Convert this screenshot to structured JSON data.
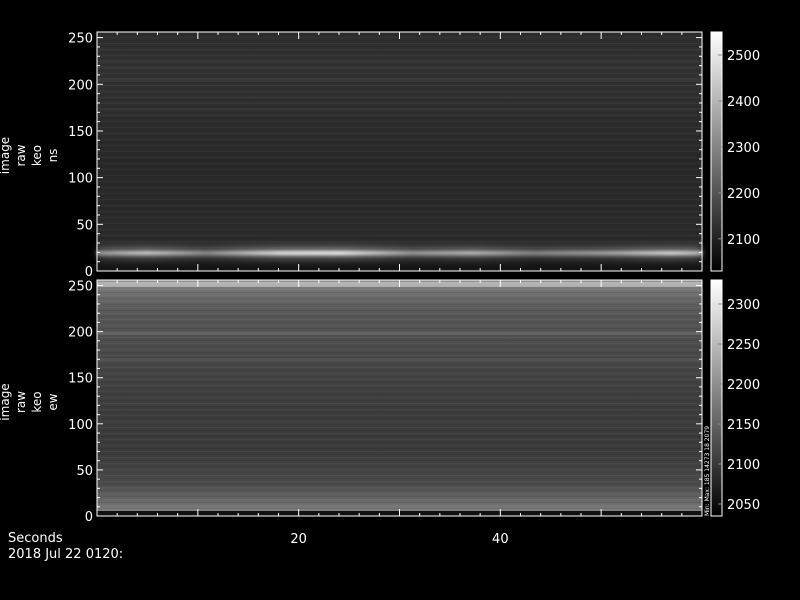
{
  "chart_data": [
    {
      "type": "heatmap",
      "panel": "top",
      "ylabel_lines": [
        "image",
        "raw",
        "keo",
        "ns"
      ],
      "ylim": [
        0,
        256
      ],
      "yticks": [
        0,
        50,
        100,
        150,
        200,
        250
      ],
      "xlim": [
        0,
        60
      ],
      "colorbar": {
        "min": 2030,
        "max": 2550,
        "ticks": [
          2100,
          2200,
          2300,
          2400,
          2500
        ]
      },
      "features": [
        {
          "row": 14,
          "description": "bright aurora band",
          "peak_value": 2550
        },
        {
          "row_range": [
            0,
            12
          ],
          "description": "dark base",
          "value": 2030
        }
      ]
    },
    {
      "type": "heatmap",
      "panel": "bottom",
      "ylabel_lines": [
        "image",
        "raw",
        "keo",
        "ew"
      ],
      "ylim": [
        0,
        256
      ],
      "yticks": [
        0,
        50,
        100,
        150,
        200,
        250
      ],
      "xlim": [
        0,
        60
      ],
      "colorbar": {
        "min": 2035,
        "max": 2330,
        "ticks": [
          2050,
          2100,
          2150,
          2200,
          2250,
          2300
        ]
      },
      "colorbar_note": "Min: Max: 185 14273 18 2079"
    }
  ],
  "xaxis": {
    "label": "Seconds",
    "ticks": [
      20,
      40
    ],
    "date_label": "2018 Jul 22 0120:"
  }
}
